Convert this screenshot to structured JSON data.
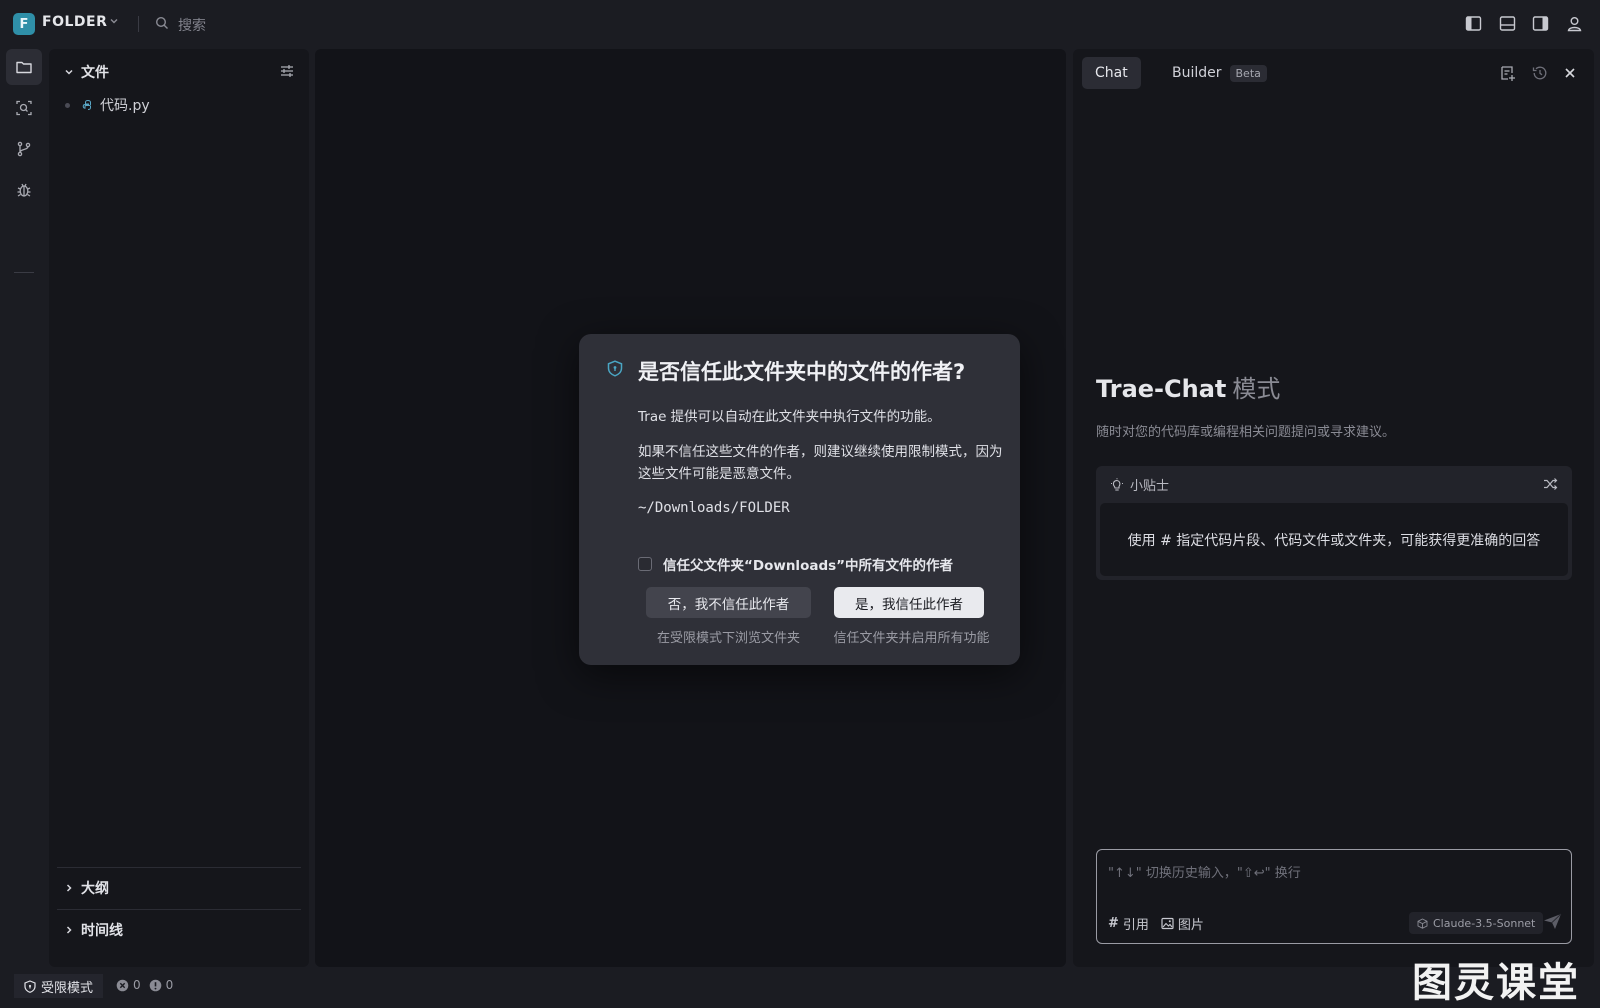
{
  "titlebar": {
    "project_initial": "F",
    "project_name": "FOLDER",
    "search_placeholder": "搜索"
  },
  "explorer": {
    "title": "文件",
    "files": [
      {
        "name": "代码.py"
      }
    ],
    "sections": [
      "大纲",
      "时间线"
    ]
  },
  "chat": {
    "tabs": [
      {
        "label": "Chat",
        "active": true
      },
      {
        "label": "Builder",
        "badge": "Beta"
      }
    ],
    "mode_title": "Trae-Chat",
    "mode_title_suffix": "模式",
    "mode_subtitle": "随时对您的代码库或编程相关问题提问或寻求建议。",
    "tips_title": "小贴士",
    "tip_text": "使用 # 指定代码片段、代码文件或文件夹，可能获得更准确的回答",
    "input_placeholder": "\"↑↓\" 切换历史输入，\"⇧↩\" 换行",
    "action_reference": "引用",
    "action_image": "图片",
    "model": "Claude-3.5-Sonnet"
  },
  "dialog": {
    "title": "是否信任此文件夹中的文件的作者?",
    "paragraph1": "Trae 提供可以自动在此文件夹中执行文件的功能。",
    "paragraph2": "如果不信任这些文件的作者，则建议继续使用限制模式，因为这些文件可能是恶意文件。",
    "path": "~/Downloads/FOLDER",
    "checkbox_label": "信任父文件夹“Downloads”中所有文件的作者",
    "checkbox_checked": false,
    "no_button": "否，我不信任此作者",
    "no_hint": "在受限模式下浏览文件夹",
    "yes_button": "是，我信任此作者",
    "yes_hint": "信任文件夹并启用所有功能"
  },
  "statusbar": {
    "mode_label": "受限模式",
    "errors": "0",
    "warnings": "0"
  },
  "watermark": "图灵课堂",
  "colors": {
    "background": "#1b1c22",
    "panel": "#15161b",
    "editor": "#121318",
    "dialog": "#2f3038",
    "accent": "#2f8fa8"
  }
}
